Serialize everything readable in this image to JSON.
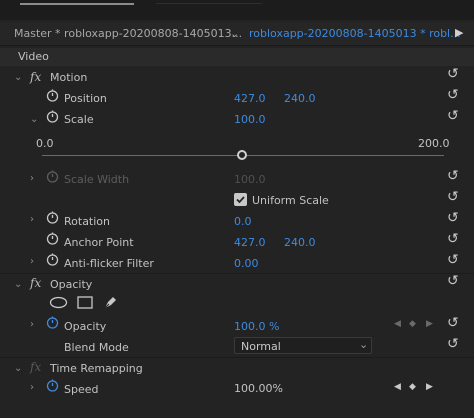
{
  "tabs": {
    "master_label": "Master * robloxapp-20200808-1405013...",
    "clip_label": "robloxapp-20200808-1405013 * robl..."
  },
  "section": "Video",
  "motion": {
    "title": "Motion",
    "position": {
      "label": "Position",
      "x": "427.0",
      "y": "240.0"
    },
    "scale": {
      "label": "Scale",
      "value": "100.0",
      "min": "0.0",
      "max": "200.0",
      "slider_fraction": 0.5
    },
    "scale_width": {
      "label": "Scale Width",
      "value": "100.0"
    },
    "uniform_scale": {
      "label": "Uniform Scale",
      "checked": true
    },
    "rotation": {
      "label": "Rotation",
      "value": "0.0"
    },
    "anchor_point": {
      "label": "Anchor Point",
      "x": "427.0",
      "y": "240.0"
    },
    "anti_flicker": {
      "label": "Anti-flicker Filter",
      "value": "0.00"
    }
  },
  "opacity": {
    "title": "Opacity",
    "value_label": "Opacity",
    "value": "100.0 %",
    "blend_label": "Blend Mode",
    "blend_value": "Normal"
  },
  "time_remapping": {
    "title": "Time Remapping",
    "speed_label": "Speed",
    "speed_value": "100.00%"
  },
  "colors": {
    "accent": "#3d8ae0",
    "background": "#232323"
  }
}
